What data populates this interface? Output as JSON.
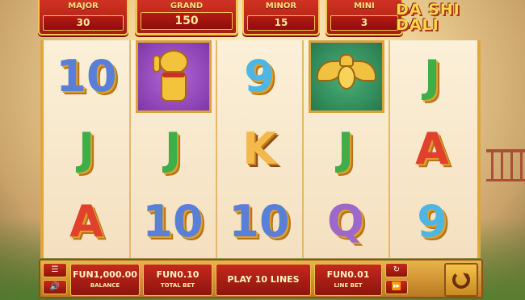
{
  "jackpots": {
    "major": {
      "label": "MAJOR",
      "value": "30"
    },
    "grand": {
      "label": "GRAND",
      "value": "150"
    },
    "minor": {
      "label": "MINOR",
      "value": "15"
    },
    "mini": {
      "label": "MINI",
      "value": "3"
    }
  },
  "logo": {
    "line1": "DA SHI",
    "line2": "DALI"
  },
  "reels": [
    [
      {
        "text": "10",
        "color": "blue"
      },
      {
        "text": "J",
        "color": "green"
      },
      {
        "text": "A",
        "color": "red"
      }
    ],
    [
      {
        "tile": "lucky-cat",
        "bg": "purple"
      },
      {
        "text": "J",
        "color": "green"
      },
      {
        "text": "10",
        "color": "blue"
      }
    ],
    [
      {
        "text": "9",
        "color": "cyan"
      },
      {
        "text": "K",
        "color": "gold"
      },
      {
        "text": "10",
        "color": "blue"
      }
    ],
    [
      {
        "tile": "golden-bat",
        "bg": "green"
      },
      {
        "text": "J",
        "color": "green"
      },
      {
        "text": "Q",
        "color": "purple"
      }
    ],
    [
      {
        "text": "J",
        "color": "green"
      },
      {
        "text": "A",
        "color": "red"
      },
      {
        "text": "9",
        "color": "cyan"
      }
    ]
  ],
  "controls": {
    "menu_icon": "menu-icon",
    "sound_icon": "speaker-icon",
    "balance": {
      "value": "FUN1,000.00",
      "label": "BALANCE"
    },
    "total_bet": {
      "value": "FUN0.10",
      "label": "TOTAL BET"
    },
    "play_lines": "PLAY 10 LINES",
    "line_bet": {
      "value": "FUN0.01",
      "label": "LINE BET"
    },
    "autoplay_icon": "autoplay-icon",
    "turbo_icon": "fast-forward-icon",
    "spin_icon": "spin-icon"
  }
}
